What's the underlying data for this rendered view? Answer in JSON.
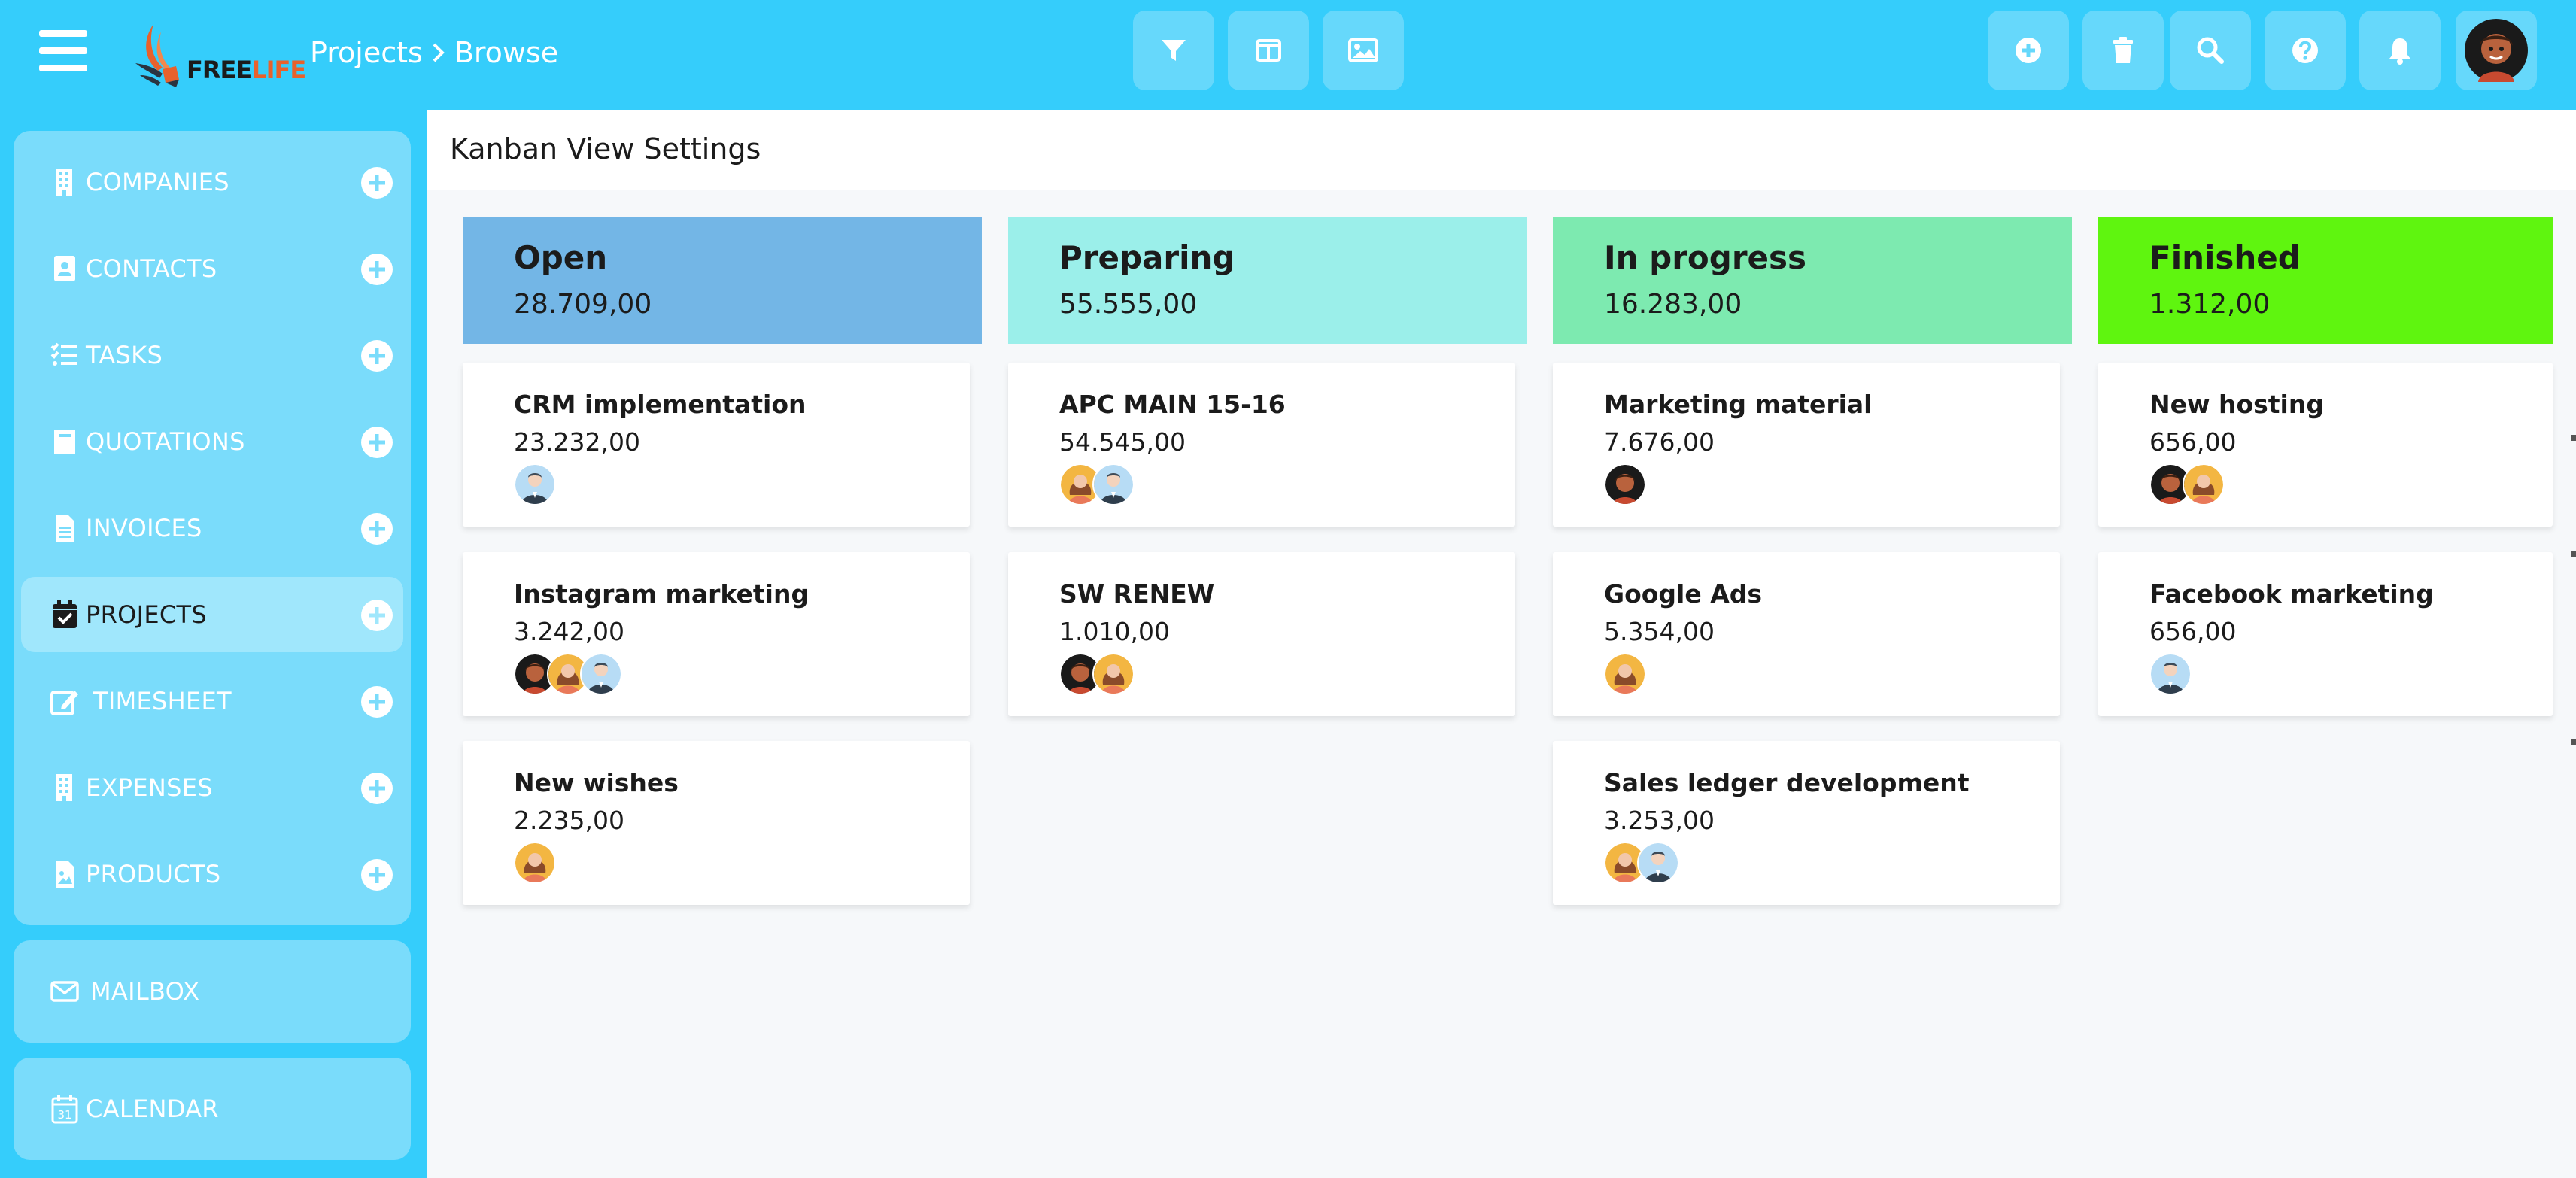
{
  "header": {
    "breadcrumb": [
      "Projects",
      "Browse"
    ],
    "logo": {
      "free": "FREE",
      "life": "LIFE"
    },
    "toolbar_icons": [
      "filter-icon",
      "columns-icon",
      "image-icon"
    ],
    "action_icons": [
      "plus-circle-icon",
      "trash-icon",
      "search-icon",
      "help-icon",
      "bell-icon"
    ],
    "brand_color": "#35cdfb"
  },
  "sidebar": {
    "items": [
      {
        "label": "COMPANIES",
        "icon": "building-icon"
      },
      {
        "label": "CONTACTS",
        "icon": "contact-card-icon"
      },
      {
        "label": "TASKS",
        "icon": "tasks-icon"
      },
      {
        "label": "QUOTATIONS",
        "icon": "book-icon"
      },
      {
        "label": "INVOICES",
        "icon": "file-icon"
      },
      {
        "label": "PROJECTS",
        "icon": "calendar-check-icon",
        "active": true
      },
      {
        "label": "TIMESHEET",
        "icon": "edit-icon"
      },
      {
        "label": "EXPENSES",
        "icon": "building-icon"
      },
      {
        "label": "PRODUCTS",
        "icon": "file-image-icon"
      }
    ],
    "mailbox": {
      "label": "MAILBOX",
      "icon": "envelope-icon"
    },
    "calendar": {
      "label": "CALENDAR",
      "icon": "calendar-icon"
    }
  },
  "main": {
    "title": "Kanban View Settings",
    "columns": [
      {
        "title": "Open",
        "total": "28.709,00",
        "color": "#73b6e6",
        "cards": [
          {
            "title": "CRM implementation",
            "value": "23.232,00",
            "avatars": [
              "man"
            ]
          },
          {
            "title": "Instagram marketing",
            "value": "3.242,00",
            "avatars": [
              "dark",
              "woman",
              "man"
            ]
          },
          {
            "title": "New wishes",
            "value": "2.235,00",
            "avatars": [
              "woman"
            ]
          }
        ]
      },
      {
        "title": "Preparing",
        "total": "55.555,00",
        "color": "#9befea",
        "cards": [
          {
            "title": "APC MAIN 15-16",
            "value": "54.545,00",
            "avatars": [
              "woman",
              "man"
            ]
          },
          {
            "title": "SW RENEW",
            "value": "1.010,00",
            "avatars": [
              "dark",
              "woman"
            ]
          }
        ]
      },
      {
        "title": "In progress",
        "total": "16.283,00",
        "color": "#7deab0",
        "cards": [
          {
            "title": "Marketing material",
            "value": "7.676,00",
            "avatars": [
              "dark"
            ]
          },
          {
            "title": "Google Ads",
            "value": "5.354,00",
            "avatars": [
              "woman"
            ]
          },
          {
            "title": "Sales ledger development",
            "value": "3.253,00",
            "avatars": [
              "woman",
              "man"
            ]
          }
        ]
      },
      {
        "title": "Finished",
        "total": "1.312,00",
        "color": "#5ff50f",
        "cards": [
          {
            "title": "New hosting",
            "value": "656,00",
            "avatars": [
              "dark",
              "woman"
            ]
          },
          {
            "title": "Facebook marketing",
            "value": "656,00",
            "avatars": [
              "man"
            ]
          }
        ]
      }
    ]
  }
}
